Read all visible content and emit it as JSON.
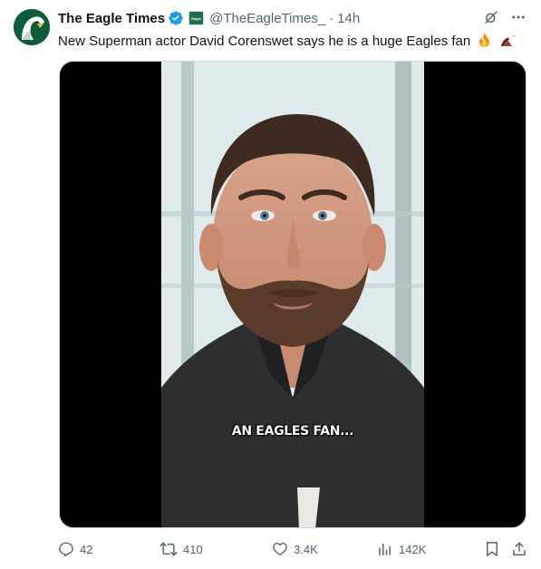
{
  "account": {
    "name": "The Eagle Times",
    "handle": "@TheEagleTimes_",
    "separator": "·",
    "time": "14h",
    "affiliate_badge_text": "Eagle"
  },
  "tweet": {
    "text": "New Superman actor David Corenswet says he is a huge Eagles fan",
    "emojis": [
      "fire-emoji",
      "eagle-emoji"
    ]
  },
  "media": {
    "caption": "AN EAGLES FAN..."
  },
  "actions": {
    "replies": "42",
    "reposts": "410",
    "likes": "3.4K",
    "views": "142K"
  },
  "colors": {
    "muted": "#536471",
    "verified": "#1d9bf0",
    "brand_green": "#0d5c3a"
  }
}
